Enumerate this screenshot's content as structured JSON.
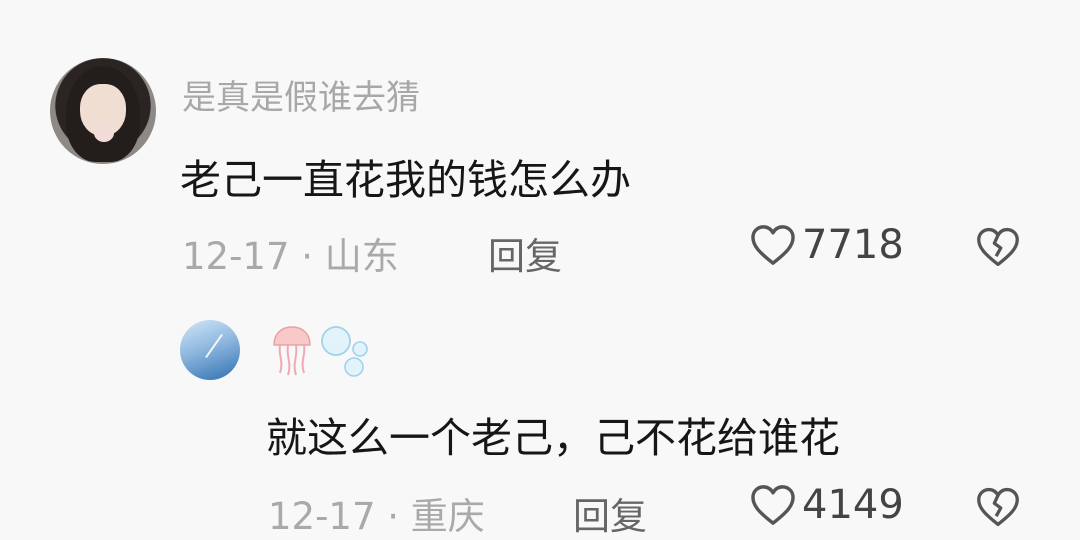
{
  "comment": {
    "username": "是真是假谁去猜",
    "content": "老己一直花我的钱怎么办",
    "meta": "12-17 · 山东",
    "reply_label": "回复",
    "like_count": "7718"
  },
  "reply": {
    "username_icons": [
      "jellyfish-icon",
      "bubbles-icon"
    ],
    "content": "就这么一个老己，己不花给谁花",
    "meta": "12-17 · 重庆",
    "reply_label": "回复",
    "like_count": "4149"
  },
  "colors": {
    "background": "#f8f8f8",
    "username": "#a8a8a8",
    "content": "#161616",
    "meta": "#a9a9a9",
    "icon": "#555555"
  }
}
